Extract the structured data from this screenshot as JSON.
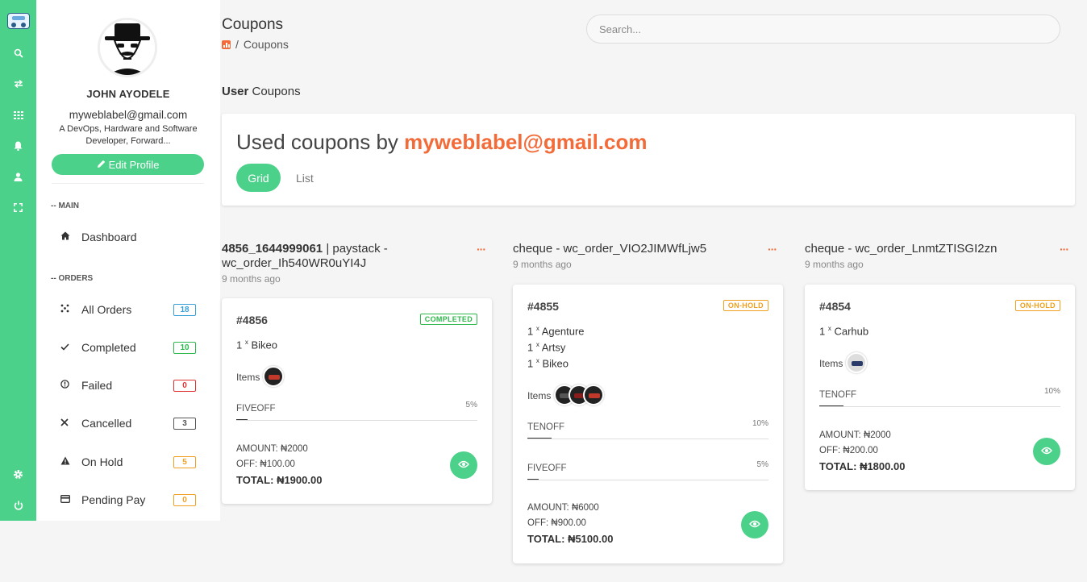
{
  "sidebar_icons": [
    "logo-icon",
    "search-icon",
    "swap-icon",
    "grid-icon",
    "bell-icon",
    "user-icon",
    "fullscreen-icon",
    "gear-icon",
    "power-icon"
  ],
  "profile": {
    "name": "JOHN AYODELE",
    "email": "myweblabel@gmail.com",
    "bio": "A DevOps, Hardware and Software Developer, Forward...",
    "edit_label": "Edit Profile"
  },
  "nav": {
    "main_section": "-- MAIN",
    "dashboard": "Dashboard",
    "orders_section": "-- ORDERS",
    "items": [
      {
        "label": "All Orders",
        "count": "18",
        "color": "#3aa0d8",
        "icon": "all-orders-icon"
      },
      {
        "label": "Completed",
        "count": "10",
        "color": "#2db84b",
        "icon": "check-icon"
      },
      {
        "label": "Failed",
        "count": "0",
        "color": "#e03131",
        "icon": "alert-icon"
      },
      {
        "label": "Cancelled",
        "count": "3",
        "color": "#555555",
        "icon": "close-icon"
      },
      {
        "label": "On Hold",
        "count": "5",
        "color": "#f0a020",
        "icon": "warning-icon"
      },
      {
        "label": "Pending Pay",
        "count": "0",
        "color": "#f0a020",
        "icon": "card-icon"
      }
    ]
  },
  "header": {
    "title": "Coupons",
    "crumb": "Coupons",
    "search_placeholder": "Search..."
  },
  "section": {
    "strong": "User",
    "rest": "Coupons"
  },
  "hero": {
    "prefix": "Used coupons by",
    "email": "myweblabel@gmail.com",
    "tab_grid": "Grid",
    "tab_list": "List"
  },
  "colors": {
    "accent": "#4cd18a",
    "brand_orange": "#f26b38",
    "completed": "#2db84b",
    "on_hold": "#f0a020"
  },
  "coupons": [
    {
      "head_bold": "4856_1644999061",
      "head_rest": "| paystack - wc_order_Ih540WR0uYI4J",
      "ago": "9 months ago",
      "order": "#4856",
      "status": "COMPLETED",
      "items": [
        {
          "qty": "1",
          "name": "Bikeo"
        }
      ],
      "items_label": "Items",
      "codes": [
        {
          "code": "FIVEOFF",
          "pct": "5%"
        }
      ],
      "amount": "AMOUNT: ₦2000",
      "off": "OFF: ₦100.00",
      "total": "TOTAL: ₦1900.00"
    },
    {
      "head_bold": "",
      "head_rest": "cheque - wc_order_VIO2JIMWfLjw5",
      "ago": "9 months ago",
      "order": "#4855",
      "status": "ON-HOLD",
      "items": [
        {
          "qty": "1",
          "name": "Agenture"
        },
        {
          "qty": "1",
          "name": "Artsy"
        },
        {
          "qty": "1",
          "name": "Bikeo"
        }
      ],
      "items_label": "Items",
      "codes": [
        {
          "code": "TENOFF",
          "pct": "10%"
        },
        {
          "code": "FIVEOFF",
          "pct": "5%"
        }
      ],
      "amount": "AMOUNT: ₦6000",
      "off": "OFF: ₦900.00",
      "total": "TOTAL: ₦5100.00"
    },
    {
      "head_bold": "",
      "head_rest": "cheque - wc_order_LnmtZTISGI2zn",
      "ago": "9 months ago",
      "order": "#4854",
      "status": "ON-HOLD",
      "items": [
        {
          "qty": "1",
          "name": "Carhub"
        }
      ],
      "items_label": "Items",
      "codes": [
        {
          "code": "TENOFF",
          "pct": "10%"
        }
      ],
      "amount": "AMOUNT: ₦2000",
      "off": "OFF: ₦200.00",
      "total": "TOTAL: ₦1800.00"
    }
  ]
}
